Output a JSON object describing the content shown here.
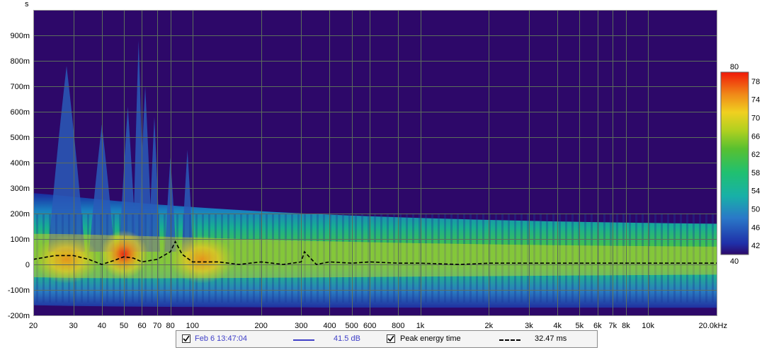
{
  "chart_data": {
    "type": "heatmap",
    "ylabel": "s",
    "x_ticks": [
      "20",
      "30",
      "40",
      "50",
      "60",
      "70",
      "80",
      "100",
      "200",
      "300",
      "400",
      "500",
      "600",
      "800",
      "1k",
      "2k",
      "3k",
      "4k",
      "5k",
      "6k",
      "7k",
      "8k",
      "10k",
      "20.0kHz"
    ],
    "x_tick_values": [
      20,
      30,
      40,
      50,
      60,
      70,
      80,
      100,
      200,
      300,
      400,
      500,
      600,
      800,
      1000,
      2000,
      3000,
      4000,
      5000,
      6000,
      7000,
      8000,
      10000,
      20000
    ],
    "xlim": [
      20,
      20000
    ],
    "x_scale": "log",
    "y_ticks": [
      "900m",
      "800m",
      "700m",
      "600m",
      "500m",
      "400m",
      "300m",
      "200m",
      "100m",
      "0",
      "-100m",
      "-200m"
    ],
    "y_tick_values": [
      0.9,
      0.8,
      0.7,
      0.6,
      0.5,
      0.4,
      0.3,
      0.2,
      0.1,
      0,
      -0.1,
      -0.2
    ],
    "ylim": [
      -0.2,
      1.0
    ],
    "grid": true,
    "colorbar": {
      "labels": [
        "80",
        "78",
        "74",
        "70",
        "66",
        "62",
        "58",
        "54",
        "50",
        "46",
        "42",
        "40"
      ],
      "values": [
        80,
        78,
        74,
        70,
        66,
        62,
        58,
        54,
        50,
        46,
        42,
        40
      ],
      "range": [
        40,
        80
      ]
    },
    "series": [
      {
        "name": "Peak energy time",
        "x": [
          20,
          25,
          30,
          35,
          40,
          45,
          50,
          55,
          60,
          70,
          80,
          84,
          90,
          100,
          130,
          160,
          200,
          250,
          300,
          310,
          350,
          400,
          500,
          600,
          800,
          1000,
          1500,
          2000,
          3000,
          4000,
          6000,
          8000,
          10000,
          15000,
          20000
        ],
        "y": [
          0.02,
          0.035,
          0.035,
          0.02,
          0.0,
          0.015,
          0.03,
          0.025,
          0.01,
          0.02,
          0.05,
          0.09,
          0.04,
          0.01,
          0.01,
          0.0,
          0.01,
          0.0,
          0.01,
          0.05,
          0.0,
          0.01,
          0.005,
          0.01,
          0.005,
          0.005,
          0.0,
          0.005,
          0.005,
          0.005,
          0.005,
          0.005,
          0.005,
          0.005,
          0.005
        ]
      }
    ],
    "highlights": [
      {
        "x": 50,
        "y": 0.04,
        "level": 78
      },
      {
        "x": 28,
        "y": 0.02,
        "level": 74
      },
      {
        "x": 110,
        "y": 0.02,
        "level": 70
      }
    ]
  },
  "legend": {
    "timestamp": "Feb 6 13:47:04",
    "level": "41.5 dB",
    "peak_label": "Peak energy time",
    "peak_value": "32.47 ms"
  },
  "colors": {
    "background": "#2d0869",
    "grid": "#5c6e5c",
    "trace": "#000000",
    "measurement_line": "#4040c8"
  }
}
